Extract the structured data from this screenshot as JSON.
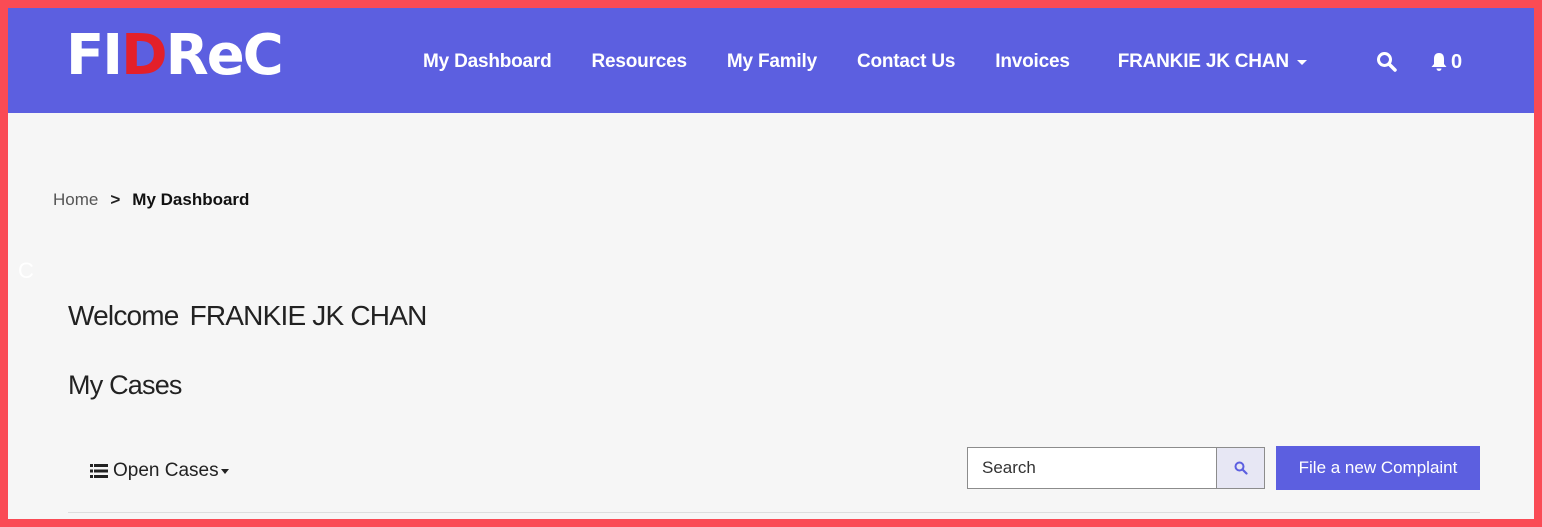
{
  "header": {
    "logo_part1": "FI",
    "logo_part2": "D",
    "logo_part3": "ReC",
    "nav": {
      "dashboard": "My Dashboard",
      "resources": "Resources",
      "family": "My Family",
      "contact": "Contact Us",
      "invoices": "Invoices"
    },
    "user_name": "FRANKIE JK CHAN",
    "notification_count": "0"
  },
  "breadcrumb": {
    "home": "Home",
    "separator": ">",
    "current": "My Dashboard"
  },
  "stray_text": "C",
  "welcome": {
    "prefix": "Welcome",
    "name": "FRANKIE JK CHAN"
  },
  "cases": {
    "title": "My Cases",
    "filter_label": "Open Cases",
    "search_placeholder": "Search",
    "new_complaint_label": "File a new Complaint"
  },
  "colors": {
    "brand": "#5c5fe0",
    "logo_accent": "#e3202a",
    "frame_border": "#fa4b55"
  },
  "icons": [
    "search-icon",
    "bell-icon",
    "chevron-down-icon",
    "list-icon"
  ]
}
